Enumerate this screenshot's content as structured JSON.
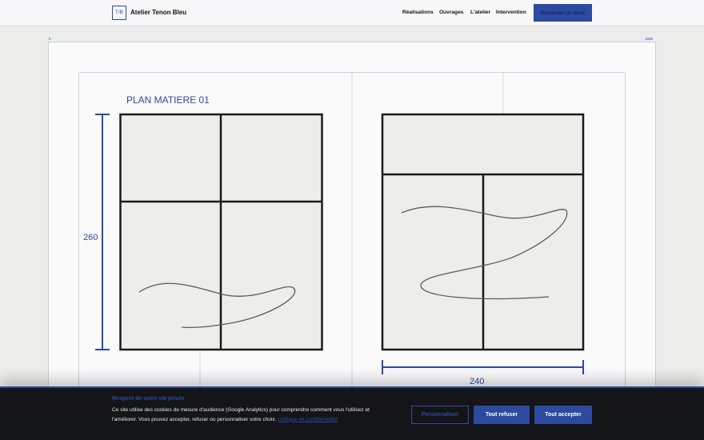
{
  "header": {
    "logo_mark": "T/B",
    "brand_name": "Atelier Tenon Bleu",
    "nav": [
      "Réalisations",
      "Ouvrages",
      "L'atelier",
      "Intervention"
    ],
    "cta_label": "Demander un devis"
  },
  "ruler": {
    "start": "0",
    "end": "1600"
  },
  "drawing": {
    "title": "PLAN MATIERE 01",
    "height_dim": "260",
    "width_dim": "240"
  },
  "cookie": {
    "title": "Respect de votre vie privée",
    "text": "Ce site utilise des cookies de mesure d'audience (Google Analytics) pour comprendre comment vous l'utilisez et l'améliorer. Vous pouvez accepter, refuser ou personnaliser votre choix.",
    "link_label": "politique de confidentialité",
    "customize_label": "Personnaliser",
    "refuse_label": "Tout refuser",
    "accept_label": "Tout accepter"
  },
  "colors": {
    "accent": "#2c4aa0",
    "ink": "#111111",
    "panel": "#ededea",
    "banner": "#141518"
  }
}
